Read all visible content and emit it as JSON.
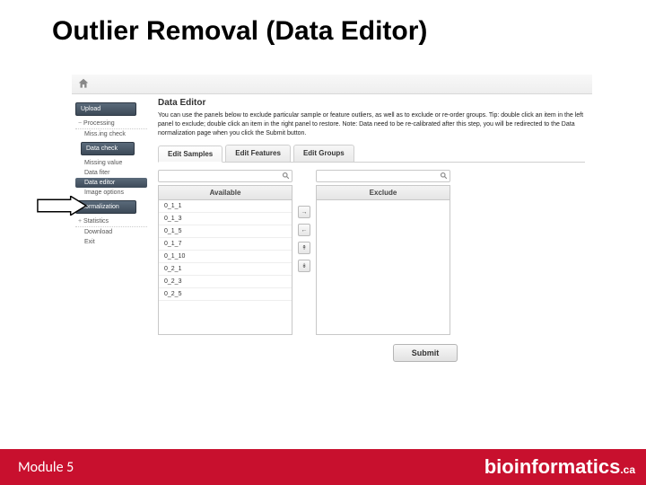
{
  "title": "Outlier Removal (Data Editor)",
  "topbar": {
    "home_icon": "home-icon"
  },
  "sidebar": {
    "upload_label": "Upload",
    "processing_label": "Processing",
    "items": {
      "missingcheck": "Miss.ing check",
      "datacheck": "Data check",
      "missingvalue": "Missing value",
      "datafiter": "Data fiter",
      "dataeditor": "Data editor",
      "imageoptions": "Image options"
    },
    "normalization_label": "Normalization",
    "statistics_label": "Statistics",
    "download_label": "Download",
    "exit_label": "Exit"
  },
  "panel": {
    "title": "Data Editor",
    "instructions": "You can use the panels below to exclude particular sample or feature outliers, as well as to exclude or re-order groups. Tip: double click an item in the left panel to exclude; double click an item in the right panel to restore. Note: Data need to be re-calibrated after this step, you will be redirected to the Data normalization page when you click the Submit button."
  },
  "tabs": {
    "samples": "Edit Samples",
    "features": "Edit Features",
    "groups": "Edit Groups"
  },
  "columns": {
    "available": "Available",
    "exclude": "Exclude",
    "search_placeholder": ""
  },
  "available_items": [
    "0_1_1",
    "0_1_3",
    "0_1_5",
    "0_1_7",
    "0_1_10",
    "0_2_1",
    "0_2_3",
    "0_2_5"
  ],
  "buttons": {
    "move_right": "→",
    "move_left": "←",
    "move_top": "↟",
    "move_bottom": "↡",
    "submit": "Submit"
  },
  "footer": {
    "module": "Module 5",
    "brand": "bioinformatics",
    "tld": ".ca"
  }
}
